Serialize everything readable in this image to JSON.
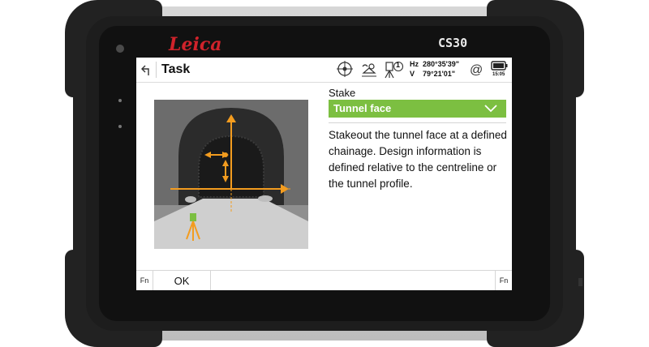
{
  "device": {
    "brand": "Leica",
    "model": "CS30"
  },
  "header": {
    "title": "Task",
    "angle_hz_label": "Hz",
    "angle_hz_value": "280°35'39\"",
    "angle_v_label": "V",
    "angle_v_value": "79°21'01\"",
    "prism_badge": "1",
    "clock": "15:05",
    "icons": [
      "back-arrow-icon",
      "target-search-icon",
      "prism-type-icon",
      "total-station-icon",
      "at-sign-icon",
      "battery-icon"
    ]
  },
  "stake": {
    "label": "Stake",
    "selected": "Tunnel face",
    "description": "Stakeout the tunnel face at a defined chainage. Design information is defined relative to the centreline or the tunnel profile."
  },
  "softkeys": {
    "fn_left": "Fn",
    "ok": "OK",
    "fn_right": "Fn"
  },
  "colors": {
    "accent_green": "#7cbf41",
    "arrow_orange": "#f39c1f",
    "brand_red": "#d0232b"
  }
}
